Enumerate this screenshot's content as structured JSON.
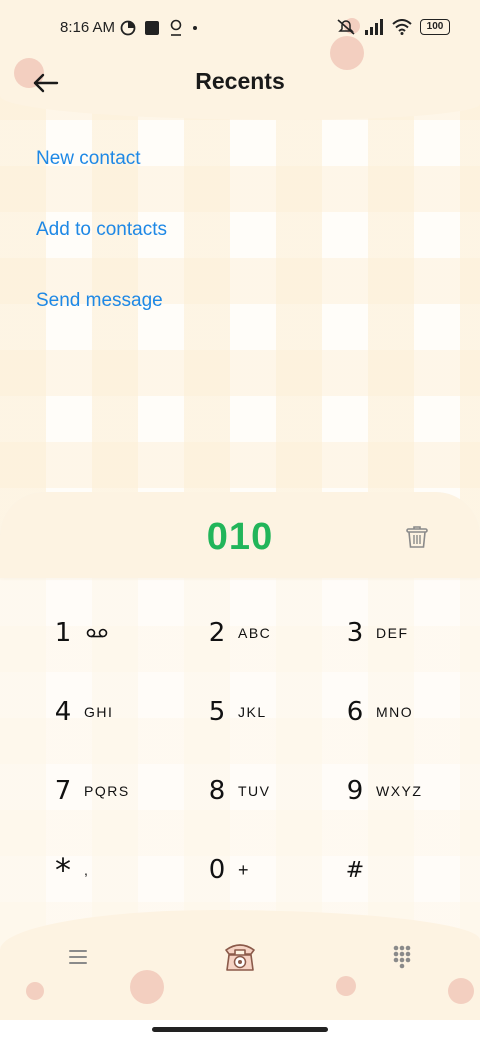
{
  "status_bar": {
    "time": "8:16 AM",
    "battery": "100",
    "left_icons": [
      "data-saver-icon",
      "square-notification-icon",
      "location-notification-icon",
      "dot-icon"
    ],
    "right_icons": [
      "mute-icon",
      "signal-icon",
      "wifi-icon",
      "battery-icon"
    ]
  },
  "app_bar": {
    "title": "Recents",
    "back_icon": "arrow-left-icon"
  },
  "menu": {
    "items": [
      {
        "label": "New contact"
      },
      {
        "label": "Add to contacts"
      },
      {
        "label": "Send message"
      }
    ]
  },
  "dialer": {
    "number": "010",
    "delete_icon": "trash-icon",
    "keys": [
      {
        "digit": "1",
        "letters": "",
        "icon": "voicemail-icon"
      },
      {
        "digit": "2",
        "letters": "ABC"
      },
      {
        "digit": "3",
        "letters": "DEF"
      },
      {
        "digit": "4",
        "letters": "GHI"
      },
      {
        "digit": "5",
        "letters": "JKL"
      },
      {
        "digit": "6",
        "letters": "MNO"
      },
      {
        "digit": "7",
        "letters": "PQRS"
      },
      {
        "digit": "8",
        "letters": "TUV"
      },
      {
        "digit": "9",
        "letters": "WXYZ"
      },
      {
        "digit": "*",
        "letters": ","
      },
      {
        "digit": "0",
        "letters": "+"
      },
      {
        "digit": "#",
        "letters": ""
      }
    ]
  },
  "bottom_bar": {
    "left_icon": "menu-icon",
    "center_icon": "telephone-icon",
    "right_icon": "keypad-icon"
  },
  "colors": {
    "accent_link": "#1e88e5",
    "dial_number": "#22b55a",
    "cream": "#fdf3e2",
    "dot_pink": "#f3cfc0"
  }
}
